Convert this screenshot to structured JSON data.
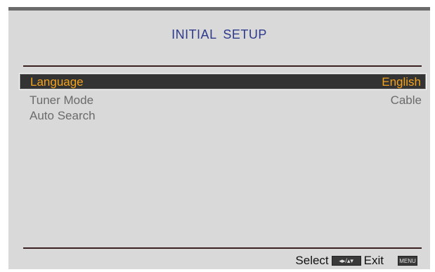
{
  "title": "INITIAL  SETUP",
  "menu": {
    "items": [
      {
        "label": "Language",
        "value": "English",
        "selected": true
      },
      {
        "label": "Tuner  Mode",
        "value": "Cable",
        "selected": false
      },
      {
        "label": "Auto  Search",
        "value": "",
        "selected": false
      }
    ]
  },
  "footer": {
    "select_label": "Select",
    "nav_icon": "◂▸/▴▾",
    "exit_label": "Exit",
    "menu_key": "MENU"
  },
  "colors": {
    "background": "#d9d9d9",
    "title": "#2e3a8c",
    "selected_text": "#f3a21c",
    "selected_bg": "#333333",
    "normal_text": "#6b6b6b"
  }
}
